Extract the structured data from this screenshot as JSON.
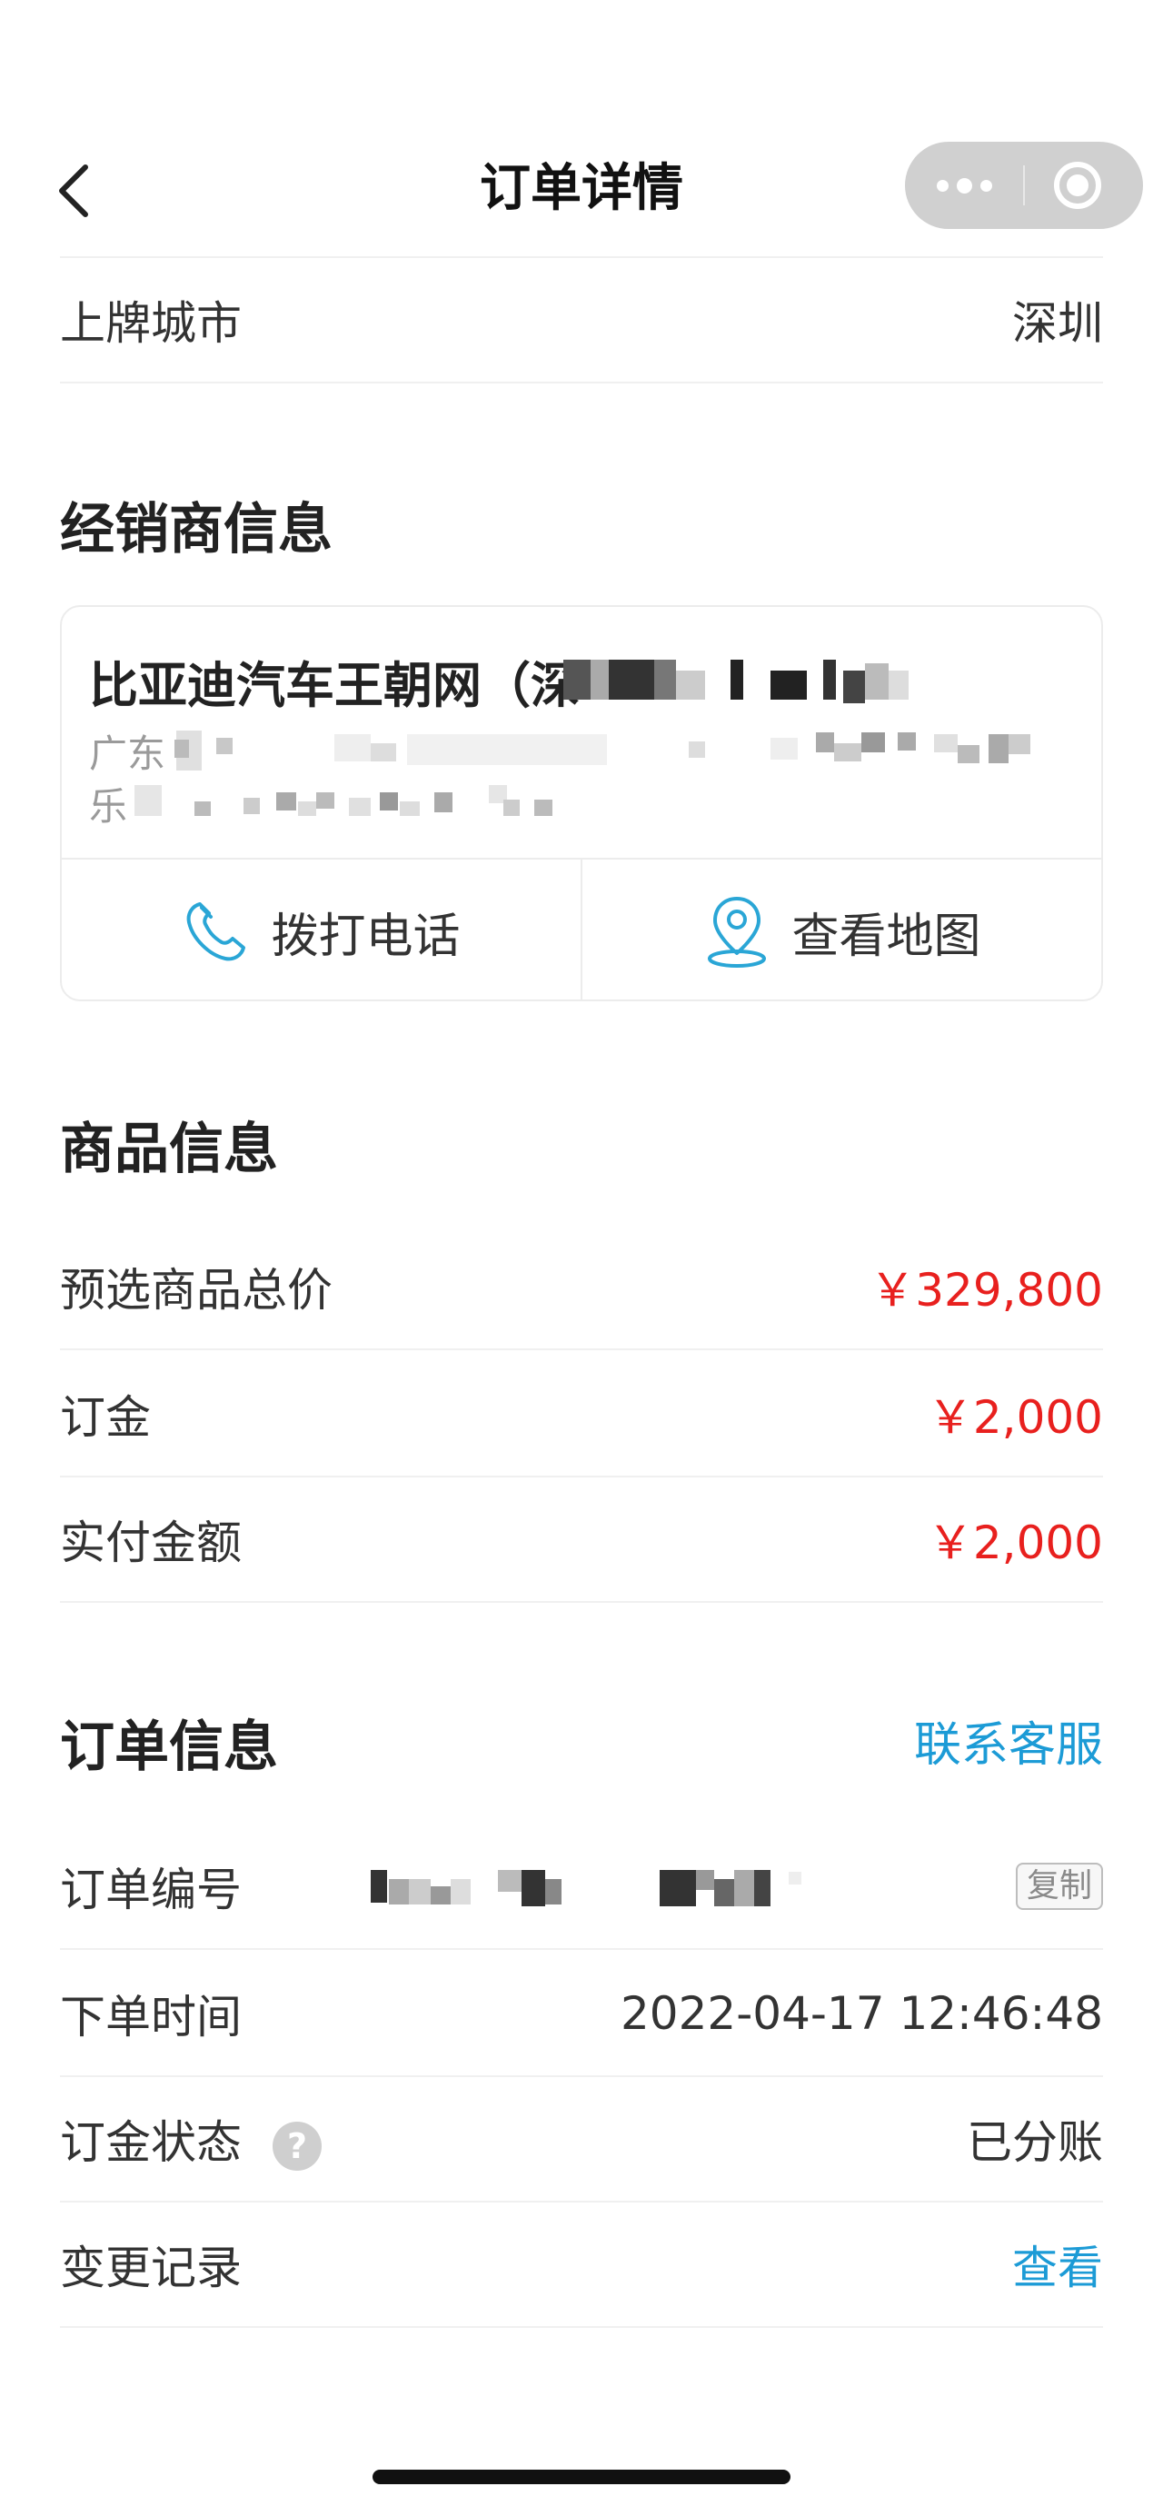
{
  "nav": {
    "title": "订单详情"
  },
  "car_info": {
    "city_label": "上牌城市",
    "city_value": "深圳"
  },
  "dealer": {
    "section_title": "经销商信息",
    "name_visible": "比亚迪汽车王朝网（深",
    "address_line1_visible": "广东",
    "address_line2_visible": "乐",
    "call_label": "拨打电话",
    "map_label": "查看地图",
    "colors": {
      "icon": "#2aa6d6"
    }
  },
  "product": {
    "section_title": "商品信息",
    "rows": [
      {
        "label": "预选商品总价",
        "value": "￥329,800"
      },
      {
        "label": "订金",
        "value": "￥2,000"
      },
      {
        "label": "实付金额",
        "value": "￥2,000"
      }
    ],
    "colors": {
      "price": "#e8201e"
    }
  },
  "order": {
    "section_title": "订单信息",
    "contact_label": "联系客服",
    "number_label": "订单编号",
    "copy_label": "复制",
    "time_label": "下单时间",
    "time_value": "2022-04-17 12:46:48",
    "status_label": "订金状态",
    "help_glyph": "?",
    "status_value": "已分账",
    "history_label": "变更记录",
    "history_link": "查看",
    "colors": {
      "link": "#1c9bd6"
    }
  }
}
